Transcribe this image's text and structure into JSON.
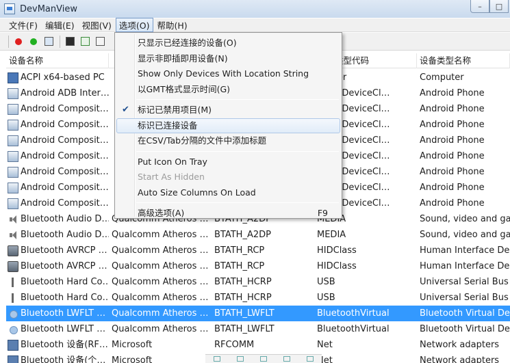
{
  "window": {
    "title": "DevManView",
    "buttons": [
      "–",
      "□"
    ]
  },
  "menubar": [
    "文件(F)",
    "编辑(E)",
    "视图(V)",
    "选项(O)",
    "帮助(H)"
  ],
  "active_menu_index": 3,
  "toolbar_icons": [
    "red-dot-icon",
    "green-dot-icon",
    "gear-icon",
    "save-icon",
    "refresh-icon",
    "copy-icon"
  ],
  "columns": [
    "设备名称",
    "",
    "",
    "类型代码",
    "设备类型名称"
  ],
  "rows": [
    {
      "icon": "computer",
      "c0": "ACPI x64-based PC",
      "c1": "",
      "c2": "",
      "c3": "nputer",
      "c4": "Computer"
    },
    {
      "icon": "phone",
      "c0": "Android ADB Inter…",
      "c1": "",
      "c2": "",
      "c3": "idUsbDeviceCl…",
      "c4": "Android Phone"
    },
    {
      "icon": "phone",
      "c0": "Android Composit…",
      "c1": "",
      "c2": "",
      "c3": "idUsbDeviceCl…",
      "c4": "Android Phone"
    },
    {
      "icon": "phone",
      "c0": "Android Composit…",
      "c1": "",
      "c2": "",
      "c3": "idUsbDeviceCl…",
      "c4": "Android Phone"
    },
    {
      "icon": "phone",
      "c0": "Android Composit…",
      "c1": "",
      "c2": "",
      "c3": "idUsbDeviceCl…",
      "c4": "Android Phone"
    },
    {
      "icon": "phone",
      "c0": "Android Composit…",
      "c1": "",
      "c2": "",
      "c3": "idUsbDeviceCl…",
      "c4": "Android Phone"
    },
    {
      "icon": "phone",
      "c0": "Android Composit…",
      "c1": "",
      "c2": "",
      "c3": "idUsbDeviceCl…",
      "c4": "Android Phone"
    },
    {
      "icon": "phone",
      "c0": "Android Composit…",
      "c1": "",
      "c2": "",
      "c3": "idUsbDeviceCl…",
      "c4": "Android Phone"
    },
    {
      "icon": "phone",
      "c0": "Android Composit…",
      "c1": "",
      "c2": "",
      "c3": "idUsbDeviceCl…",
      "c4": "Android Phone"
    },
    {
      "icon": "speaker",
      "c0": "Bluetooth Audio D…",
      "c1": "Qualcomm Atheros …",
      "c2": "BTATH_A2DP",
      "c3": "MEDIA",
      "c4": "Sound, video and ga…"
    },
    {
      "icon": "speaker",
      "c0": "Bluetooth Audio D…",
      "c1": "Qualcomm Atheros …",
      "c2": "BTATH_A2DP",
      "c3": "MEDIA",
      "c4": "Sound, video and ga…"
    },
    {
      "icon": "hid",
      "c0": "Bluetooth AVRCP …",
      "c1": "Qualcomm Atheros …",
      "c2": "BTATH_RCP",
      "c3": "HIDClass",
      "c4": "Human Interface De…"
    },
    {
      "icon": "hid",
      "c0": "Bluetooth AVRCP …",
      "c1": "Qualcomm Atheros …",
      "c2": "BTATH_RCP",
      "c3": "HIDClass",
      "c4": "Human Interface De…"
    },
    {
      "icon": "usb",
      "c0": "Bluetooth Hard Co…",
      "c1": "Qualcomm Atheros …",
      "c2": "BTATH_HCRP",
      "c3": "USB",
      "c4": "Universal Serial Bus …"
    },
    {
      "icon": "usb",
      "c0": "Bluetooth Hard Co…",
      "c1": "Qualcomm Atheros …",
      "c2": "BTATH_HCRP",
      "c3": "USB",
      "c4": "Universal Serial Bus …"
    },
    {
      "icon": "bt",
      "c0": "Bluetooth LWFLT …",
      "c1": "Qualcomm Atheros …",
      "c2": "BTATH_LWFLT",
      "c3": "BluetoothVirtual",
      "c4": "Bluetooth Virtual De…",
      "selected": true
    },
    {
      "icon": "bt",
      "c0": "Bluetooth LWFLT …",
      "c1": "Qualcomm Atheros …",
      "c2": "BTATH_LWFLT",
      "c3": "BluetoothVirtual",
      "c4": "Bluetooth Virtual De…"
    },
    {
      "icon": "net",
      "c0": "Bluetooth 设备(RF…",
      "c1": "Microsoft",
      "c2": "RFCOMM",
      "c3": "Net",
      "c4": "Network adapters"
    },
    {
      "icon": "net",
      "c0": "Bluetooth 设备(个…",
      "c1": "Microsoft",
      "c2": "",
      "c3": "Net",
      "c4": "Network adapters"
    }
  ],
  "dropdown": {
    "items": [
      {
        "label": "只显示已经连接的设备(O)"
      },
      {
        "label": "显示非即插即用设备(N)"
      },
      {
        "label": "Show Only Devices With Location String"
      },
      {
        "label": "以GMT格式显示时间(G)"
      },
      {
        "sep": true
      },
      {
        "label": "标记已禁用项目(M)",
        "checked": true
      },
      {
        "label": "标识已连接设备",
        "hover": true
      },
      {
        "label": "在CSV/Tab分隔的文件中添加标题"
      },
      {
        "sep": true
      },
      {
        "label": "Put Icon On Tray"
      },
      {
        "label": "Start As Hidden",
        "disabled": true
      },
      {
        "label": "Auto Size Columns On Load"
      },
      {
        "sep": true
      },
      {
        "label": "高级选项(A)",
        "shortcut": "F9"
      }
    ]
  }
}
